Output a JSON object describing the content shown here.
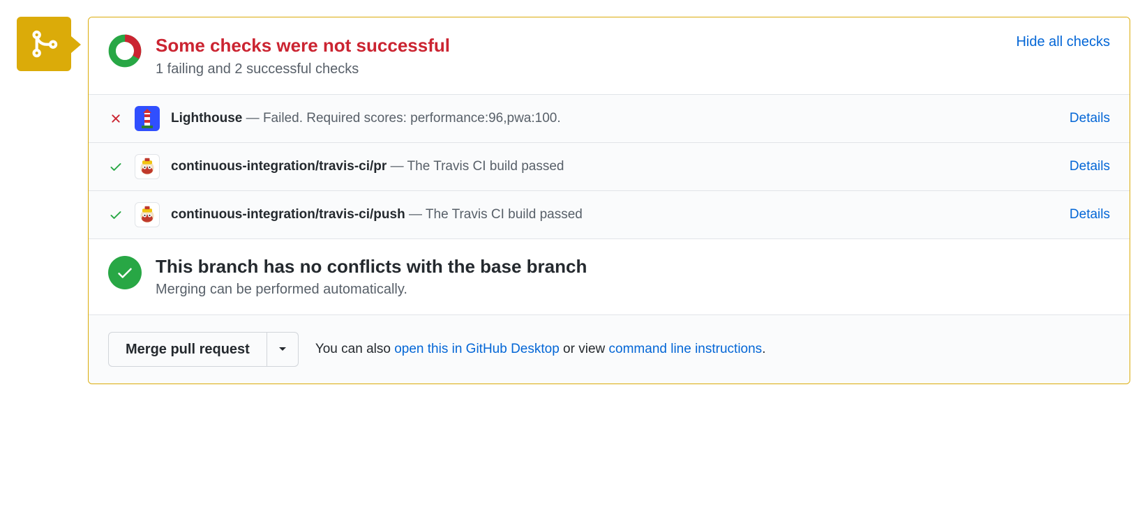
{
  "header": {
    "title": "Some checks were not successful",
    "subtitle": "1 failing and 2 successful checks",
    "hide_link": "Hide all checks"
  },
  "checks": [
    {
      "status": "fail",
      "app_icon": "lighthouse",
      "name": "Lighthouse",
      "sep": " — ",
      "message": "Failed. Required scores: performance:96,pwa:100.",
      "details": "Details"
    },
    {
      "status": "pass",
      "app_icon": "travis",
      "name": "continuous-integration/travis-ci/pr",
      "sep": " — ",
      "message": "The Travis CI build passed",
      "details": "Details"
    },
    {
      "status": "pass",
      "app_icon": "travis",
      "name": "continuous-integration/travis-ci/push",
      "sep": " — ",
      "message": "The Travis CI build passed",
      "details": "Details"
    }
  ],
  "merge_status": {
    "title": "This branch has no conflicts with the base branch",
    "subtitle": "Merging can be performed automatically."
  },
  "actions": {
    "merge_button": "Merge pull request",
    "text_prefix": "You can also ",
    "link_desktop": "open this in GitHub Desktop",
    "text_middle": " or view ",
    "link_cli": "command line instructions",
    "text_suffix": "."
  }
}
